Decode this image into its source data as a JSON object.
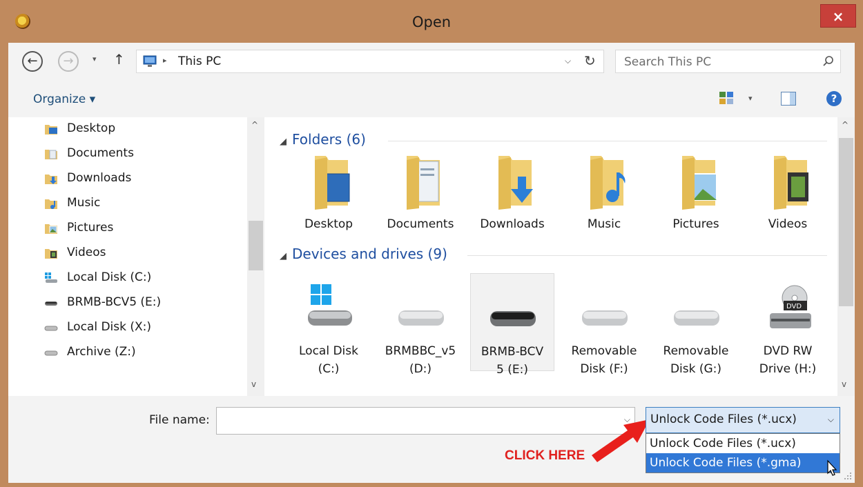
{
  "window": {
    "title": "Open",
    "close_glyph": "×"
  },
  "address": {
    "back_glyph": "←",
    "forward_glyph": "→",
    "recent_glyph": "▾",
    "up_glyph": "↑",
    "breadcrumb_sep": "▸",
    "breadcrumb": "This PC",
    "history_glyph": "⌵",
    "refresh_glyph": "↻",
    "search_placeholder": "Search This PC"
  },
  "toolbar": {
    "organize_label": "Organize ▾",
    "view_drop_glyph": "▾",
    "help_glyph": "?"
  },
  "nav": {
    "scroll_up": "^",
    "scroll_down": "v",
    "items": [
      {
        "label": "Desktop",
        "icon": "desktop-folder-icon"
      },
      {
        "label": "Documents",
        "icon": "documents-folder-icon"
      },
      {
        "label": "Downloads",
        "icon": "downloads-folder-icon"
      },
      {
        "label": "Music",
        "icon": "music-folder-icon"
      },
      {
        "label": "Pictures",
        "icon": "pictures-folder-icon"
      },
      {
        "label": "Videos",
        "icon": "videos-folder-icon"
      },
      {
        "label": "Local Disk (C:)",
        "icon": "windows-drive-icon"
      },
      {
        "label": "BRMB-BCV5 (E:)",
        "icon": "drive-icon"
      },
      {
        "label": "Local Disk (X:)",
        "icon": "network-drive-icon"
      },
      {
        "label": "Archive (Z:)",
        "icon": "network-drive-icon"
      }
    ]
  },
  "content": {
    "scroll_up": "^",
    "scroll_down": "v",
    "group_glyph": "◢",
    "folders_header": "Folders (6)",
    "folders": [
      {
        "label": "Desktop"
      },
      {
        "label": "Documents"
      },
      {
        "label": "Downloads"
      },
      {
        "label": "Music"
      },
      {
        "label": "Pictures"
      },
      {
        "label": "Videos"
      }
    ],
    "devices_header": "Devices and drives (9)",
    "devices": [
      {
        "line1": "Local Disk",
        "line2": "(C:)"
      },
      {
        "line1": "BRMBBC_v5",
        "line2": "(D:)"
      },
      {
        "line1": "BRMB-BCV",
        "line2": "5 (E:)"
      },
      {
        "line1": "Removable",
        "line2": "Disk (F:)"
      },
      {
        "line1": "Removable",
        "line2": "Disk (G:)"
      },
      {
        "line1": "DVD RW",
        "line2": "Drive (H:)"
      }
    ],
    "dvd_badge": "DVD"
  },
  "bottom": {
    "file_name_label": "File name:",
    "file_name_value": "",
    "filename_chev": "⌵",
    "file_type_selected": "Unlock Code Files (*.ucx)",
    "type_chev": "⌵",
    "file_type_options": [
      "Unlock Code Files (*.ucx)",
      "Unlock Code Files (*.gma)"
    ],
    "annotation": "CLICK HERE"
  },
  "colors": {
    "frame": "#c08a5e",
    "close": "#c7403a",
    "link_blue": "#1e4e9f",
    "highlight": "#3178d6",
    "annotation_red": "#e0201e"
  }
}
